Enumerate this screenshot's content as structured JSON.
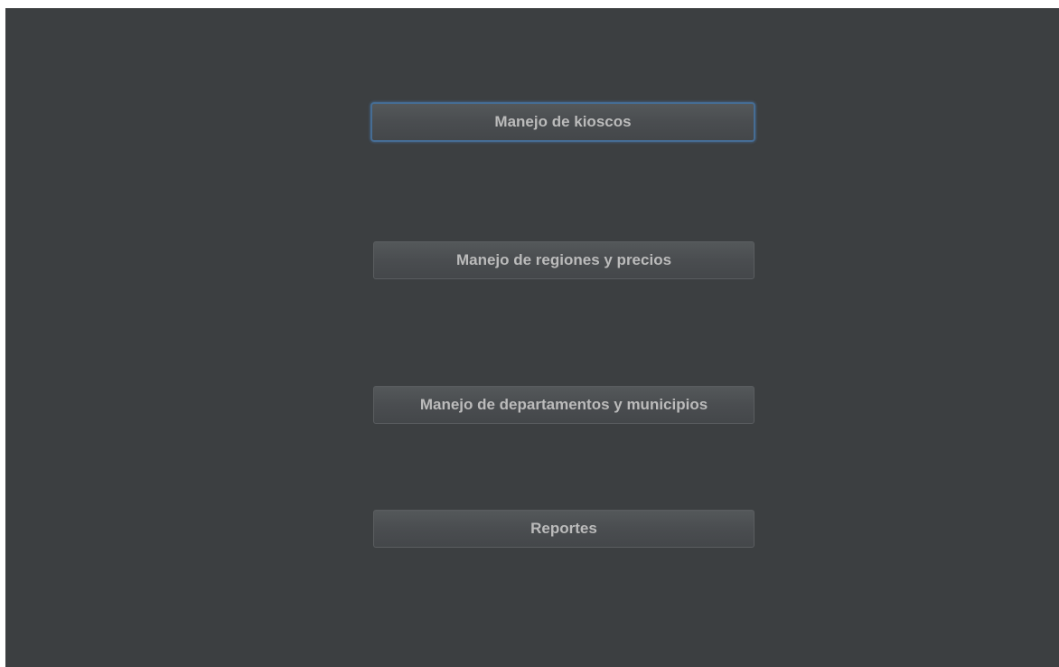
{
  "menu": {
    "buttons": [
      {
        "label": "Manejo de kioscos",
        "focused": true
      },
      {
        "label": "Manejo de regiones y precios",
        "focused": false
      },
      {
        "label": "Manejo de departamentos y municipios",
        "focused": false
      },
      {
        "label": "Reportes",
        "focused": false
      }
    ]
  },
  "colors": {
    "background": "#3c3f41",
    "button_text": "#bbbbbb",
    "focus_border": "#466d94"
  }
}
